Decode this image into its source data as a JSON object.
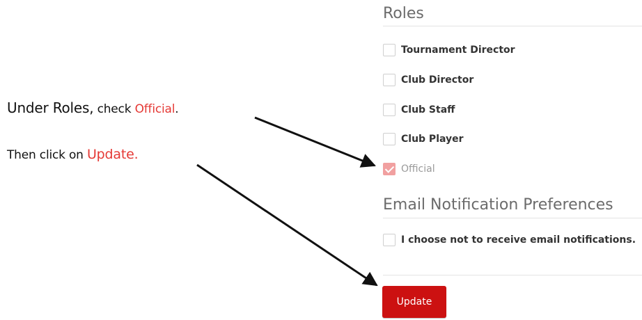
{
  "instructions": {
    "step1": {
      "prefix": "Under Roles,",
      "middle": " check ",
      "target": "Official",
      "suffix": "."
    },
    "step2": {
      "prefix": "Then click on ",
      "target": "Update."
    }
  },
  "roles": {
    "heading": "Roles",
    "items": [
      {
        "label": "Tournament Director",
        "checked": false
      },
      {
        "label": "Club Director",
        "checked": false
      },
      {
        "label": "Club Staff",
        "checked": false
      },
      {
        "label": "Club Player",
        "checked": false
      },
      {
        "label": "Official",
        "checked": true
      }
    ]
  },
  "email_prefs": {
    "heading": "Email Notification Preferences",
    "optout_label": "I choose not to receive email notifications."
  },
  "update_button": {
    "label": "Update"
  },
  "colors": {
    "accent": "#e53935",
    "button": "#cc1111",
    "checked": "#f1a0a0"
  }
}
